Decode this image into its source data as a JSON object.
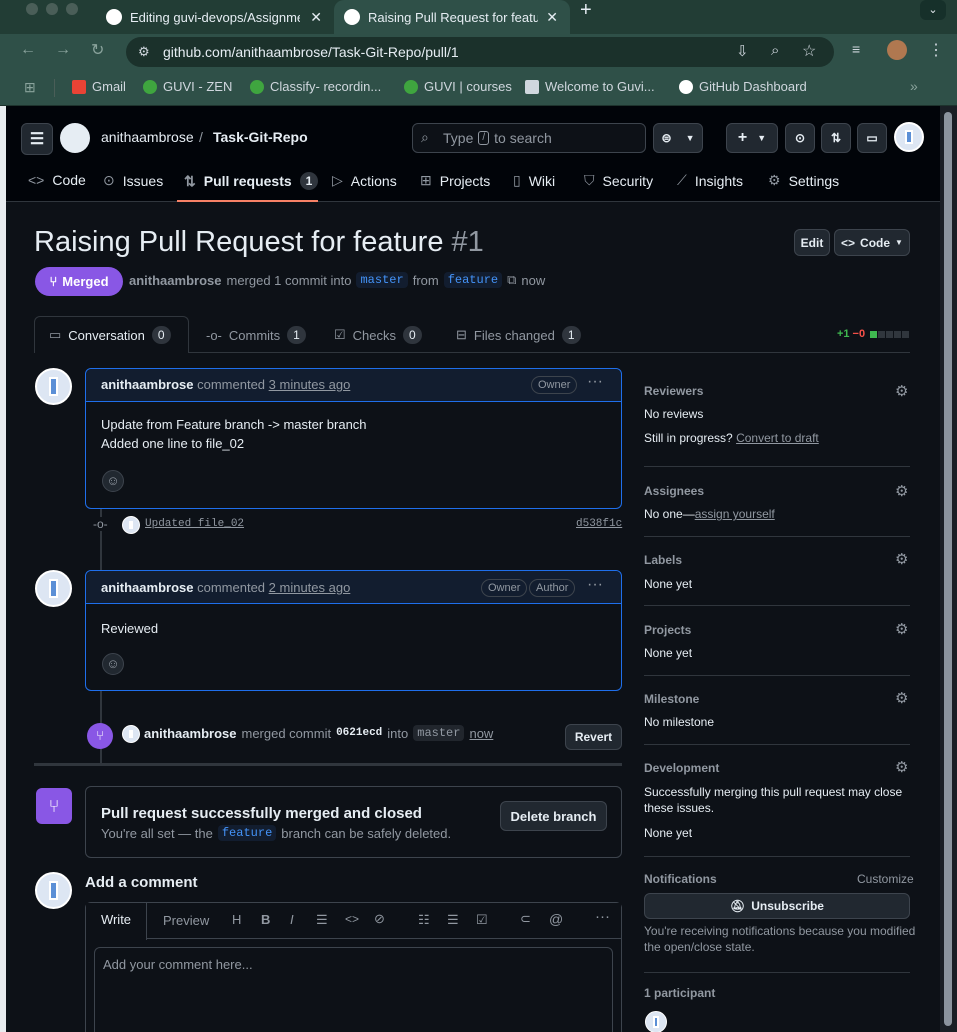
{
  "browser": {
    "tabs": [
      {
        "title": "Editing guvi-devops/Assignme"
      },
      {
        "title": "Raising Pull Request for featu"
      }
    ],
    "url": "github.com/anithaambrose/Task-Git-Repo/pull/1",
    "bookmarks": [
      "Gmail",
      "GUVI - ZEN",
      "Classify- recordin...",
      "GUVI | courses",
      "Welcome to Guvi...",
      "GitHub Dashboard"
    ]
  },
  "header": {
    "owner": "anithaambrose",
    "separator": "/",
    "repo": "Task-Git-Repo",
    "search_prefix": "Type",
    "search_key": "/",
    "search_suffix": "to search"
  },
  "nav": {
    "code": "Code",
    "issues": "Issues",
    "pulls": "Pull requests",
    "pulls_count": "1",
    "actions": "Actions",
    "projects": "Projects",
    "wiki": "Wiki",
    "security": "Security",
    "insights": "Insights",
    "settings": "Settings"
  },
  "pr": {
    "title": "Raising Pull Request for feature",
    "number": "#1",
    "edit": "Edit",
    "code_btn": "Code",
    "state": "Merged",
    "author": "anithaambrose",
    "merge_text": "merged 1 commit into",
    "base": "master",
    "from": "from",
    "head": "feature",
    "time": "now"
  },
  "tabs": {
    "conversation": "Conversation",
    "conversation_count": "0",
    "commits": "Commits",
    "commits_count": "1",
    "checks": "Checks",
    "checks_count": "0",
    "files": "Files changed",
    "files_count": "1",
    "additions": "+1",
    "deletions": "−0"
  },
  "comment1": {
    "author": "anithaambrose",
    "verb": "commented",
    "time": "3 minutes ago",
    "badge": "Owner",
    "line1": "Update from Feature branch -> master branch",
    "line2": "Added one line to file_02"
  },
  "commit": {
    "message": "Updated file_02",
    "sha": "d538f1c"
  },
  "comment2": {
    "author": "anithaambrose",
    "verb": "commented",
    "time": "2 minutes ago",
    "badge1": "Owner",
    "badge2": "Author",
    "body": "Reviewed"
  },
  "merge_event": {
    "author": "anithaambrose",
    "text": "merged commit",
    "sha": "0621ecd",
    "into": "into",
    "base": "master",
    "time": "now",
    "revert": "Revert"
  },
  "merged_box": {
    "title": "Pull request successfully merged and closed",
    "desc_pre": "You're all set — the",
    "branch": "feature",
    "desc_post": "branch can be safely deleted.",
    "delete_btn": "Delete branch"
  },
  "add_comment": {
    "heading": "Add a comment",
    "write": "Write",
    "preview": "Preview",
    "placeholder": "Add your comment here..."
  },
  "sidebar": {
    "reviewers": "Reviewers",
    "no_reviews": "No reviews",
    "in_progress": "Still in progress?",
    "convert": "Convert to draft",
    "assignees": "Assignees",
    "no_one": "No one—",
    "assign_yourself": "assign yourself",
    "labels": "Labels",
    "labels_val": "None yet",
    "projects": "Projects",
    "projects_val": "None yet",
    "milestone": "Milestone",
    "milestone_val": "No milestone",
    "development": "Development",
    "development_desc1": "Successfully merging this pull request may close",
    "development_desc2": "these issues.",
    "development_val": "None yet",
    "notifications": "Notifications",
    "customize": "Customize",
    "unsubscribe": "Unsubscribe",
    "notif_desc1": "You're receiving notifications because you modified",
    "notif_desc2": "the open/close state.",
    "participants": "1 participant"
  },
  "colors": {
    "merged": "#8957e5",
    "accent": "#1f6feb",
    "link": "#4493f8",
    "bg": "#0d1117"
  }
}
